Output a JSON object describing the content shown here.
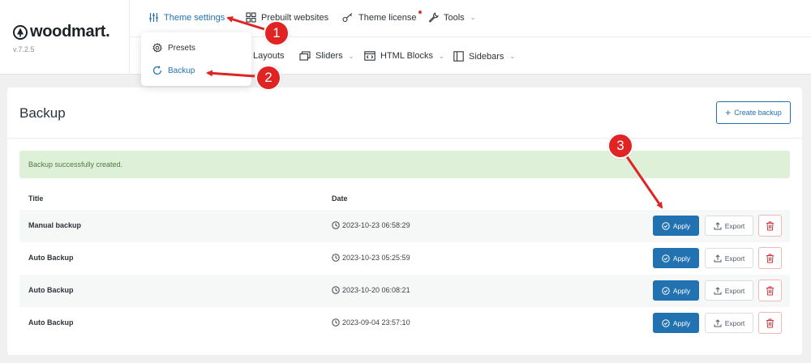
{
  "brand": {
    "name": "woodmart.",
    "version": "v.7.2.5"
  },
  "nav": {
    "theme_settings": "Theme settings",
    "prebuilt": "Prebuilt websites",
    "license": "Theme license",
    "tools": "Tools",
    "layouts": "Layouts",
    "sliders": "Sliders",
    "html_blocks": "HTML Blocks",
    "sidebars": "Sidebars"
  },
  "dropdown": {
    "presets": "Presets",
    "backup": "Backup"
  },
  "page": {
    "title": "Backup",
    "create_button": "Create backup",
    "notice": "Backup successfully created."
  },
  "table": {
    "headers": {
      "title": "Title",
      "date": "Date"
    },
    "rows": [
      {
        "title": "Manual backup",
        "date": "2023-10-23 06:58:29",
        "apply": "Apply",
        "export": "Export"
      },
      {
        "title": "Auto Backup",
        "date": "2023-10-23 05:25:59",
        "apply": "Apply",
        "export": "Export"
      },
      {
        "title": "Auto Backup",
        "date": "2023-10-20 06:08:21",
        "apply": "Apply",
        "export": "Export"
      },
      {
        "title": "Auto Backup",
        "date": "2023-09-04 23:57:10",
        "apply": "Apply",
        "export": "Export"
      }
    ]
  },
  "annotations": [
    "1",
    "2",
    "3"
  ],
  "colors": {
    "accent": "#2271b1",
    "annotation": "#e02424",
    "notice_bg": "#dff0d8",
    "danger": "#d63638"
  }
}
